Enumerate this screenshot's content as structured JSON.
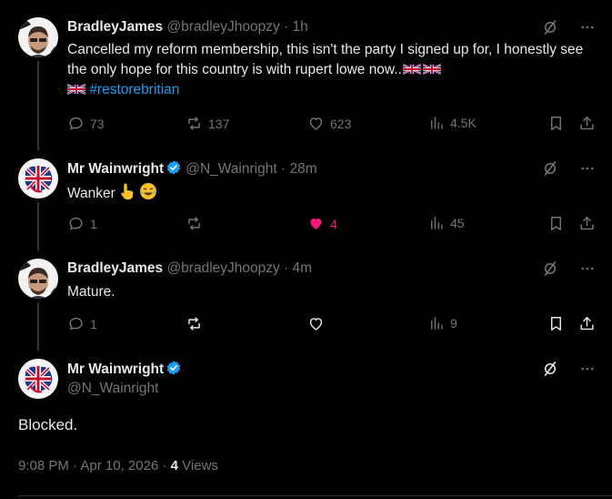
{
  "posts": [
    {
      "name": "BradleyJames",
      "handle": "@bradleyJhoopzy",
      "dot": "·",
      "time": "1h",
      "text": "Cancelled my reform membership, this isn't the party I signed up for, I honestly see the only hope for this country is with rupert lowe now..",
      "hashtag": "#restorebritian",
      "replies": "73",
      "reposts": "137",
      "likes": "623",
      "views": "4.5K"
    },
    {
      "name": "Mr Wainwright",
      "handle": "@N_Wainright",
      "dot": "·",
      "time": "28m",
      "text": "Wanker",
      "replies": "1",
      "reposts": "",
      "likes": "4",
      "views": "45"
    },
    {
      "name": "BradleyJames",
      "handle": "@bradleyJhoopzy",
      "dot": "·",
      "time": "4m",
      "text": "Mature.",
      "replies": "1",
      "reposts": "",
      "likes": "",
      "views": "9"
    }
  ],
  "main": {
    "name": "Mr Wainwright",
    "handle": "@N_Wainright",
    "text": "Blocked.",
    "time": "9:08 PM",
    "dot": "·",
    "date": "Apr 10, 2026",
    "dot2": "·",
    "views_count": "4",
    "views_label": "Views"
  },
  "colors": {
    "background": "#000000",
    "text": "#e7e9ea",
    "muted": "#71767b",
    "link": "#1d9bf0",
    "like": "#f91880",
    "verified": "#1d9bf0"
  },
  "icons": [
    "grok-icon",
    "more-icon",
    "reply-icon",
    "repost-icon",
    "like-icon",
    "views-icon",
    "bookmark-icon",
    "share-icon",
    "verified-icon"
  ]
}
